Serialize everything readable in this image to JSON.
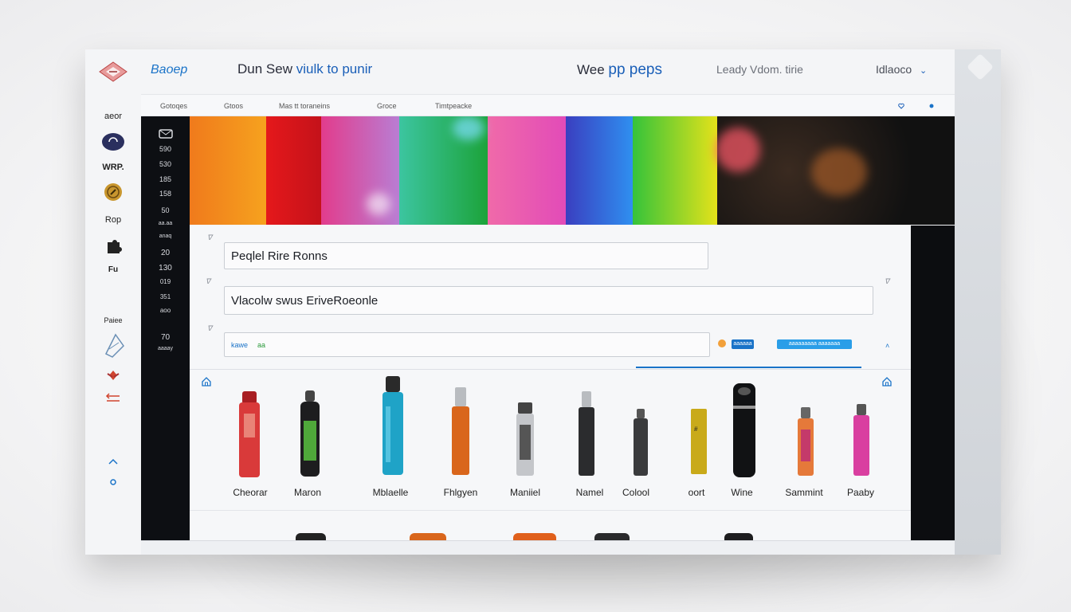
{
  "header": {
    "brand": "Baoep",
    "headline_prefix": "Dun Sew",
    "headline_accent": "viulk to punir",
    "wordmark_prefix": "Wee",
    "wordmark_accent": "pp peps",
    "language": "Leady Vdom. tirie",
    "account": "Idlaoco",
    "account_chevron": "chevron-down-icon"
  },
  "nav": {
    "items": [
      "Gotoqes",
      "Gtoos",
      "Mas tt toraneins",
      "Groce",
      "Timtpeacke"
    ]
  },
  "sidebar": {
    "items": [
      "aeor",
      "WRP.",
      "Rop",
      "Fu",
      "Paiee"
    ]
  },
  "numbers_column": [
    "590",
    "530",
    "185",
    "158",
    "50",
    "aa.aa",
    "anaq",
    "20",
    "130",
    "019",
    "351",
    "aoo",
    "70",
    "aaaay"
  ],
  "form": {
    "field1": "Peqlel Rire Ronns",
    "field2": "Vlacolw swus EriveRoeonle",
    "field3_tag1": "kawe",
    "field3_tag2": "aa",
    "chip1": "aaaaaa",
    "chip2": "aaaaaaaaa aaaaaaa"
  },
  "products": [
    {
      "label": "Cheorar",
      "color": "#d93a3a"
    },
    {
      "label": "Maron",
      "color": "#2a2a2a"
    },
    {
      "label": "Mblaelle",
      "color": "#1fa3c7"
    },
    {
      "label": "Fhlgyen",
      "color": "#d9661c"
    },
    {
      "label": "Maniiel",
      "color": "#9ca0a6"
    },
    {
      "label": "Namel",
      "color": "#2b2c2e"
    },
    {
      "label": "Colool",
      "color": "#3a3b3d"
    },
    {
      "label": "oort",
      "color": "#c9aa1a"
    },
    {
      "label": "Wine",
      "color": "#111214"
    },
    {
      "label": "Sammint",
      "color": "#e5793a"
    },
    {
      "label": "Paaby",
      "color": "#d93fa0"
    }
  ],
  "colors": {
    "accent": "#1a73c8",
    "dark": "#0d0f13",
    "panel": "#f6f7f9"
  }
}
